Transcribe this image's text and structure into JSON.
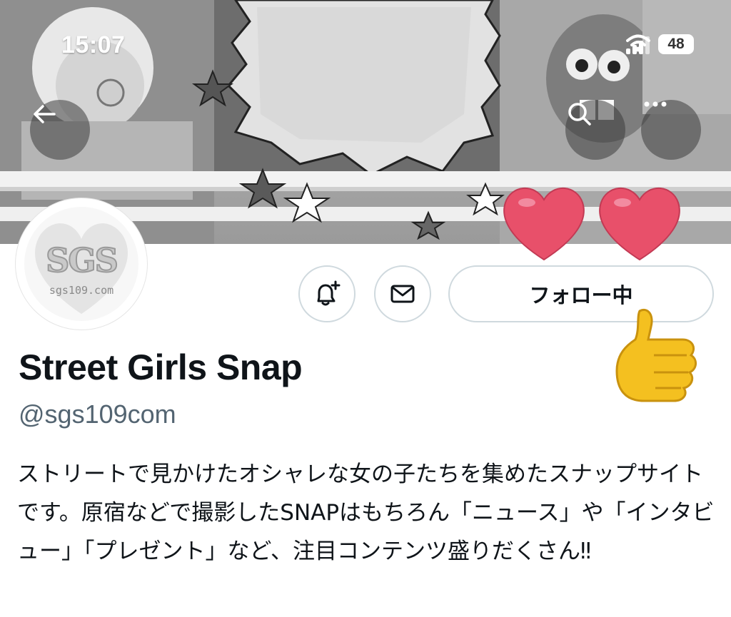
{
  "status_bar": {
    "time": "15:07",
    "battery": "48"
  },
  "header": {
    "back_icon": "arrow-left-icon",
    "search_icon": "search-icon",
    "more_icon": "more-horizontal-icon"
  },
  "avatar": {
    "logo_text": "SGS",
    "url_text": "sgs109.com"
  },
  "actions": {
    "notify_icon": "bell-plus-icon",
    "message_icon": "mail-icon",
    "follow_label": "フォロー中"
  },
  "profile": {
    "name": "Street Girls Snap",
    "handle": "@sgs109com",
    "bio": "ストリートで見かけたオシャレな女の子たちを集めたスナップサイトです。原宿などで撮影したSNAPはもちろん「ニュース」や「インタビュー」「プレゼント」など、注目コンテンツ盛りだくさん‼"
  },
  "colors": {
    "text_primary": "#0f1419",
    "text_secondary": "#536471",
    "border": "#cfd9de",
    "heart": "#e8506a",
    "thumb": "#f4c020"
  }
}
